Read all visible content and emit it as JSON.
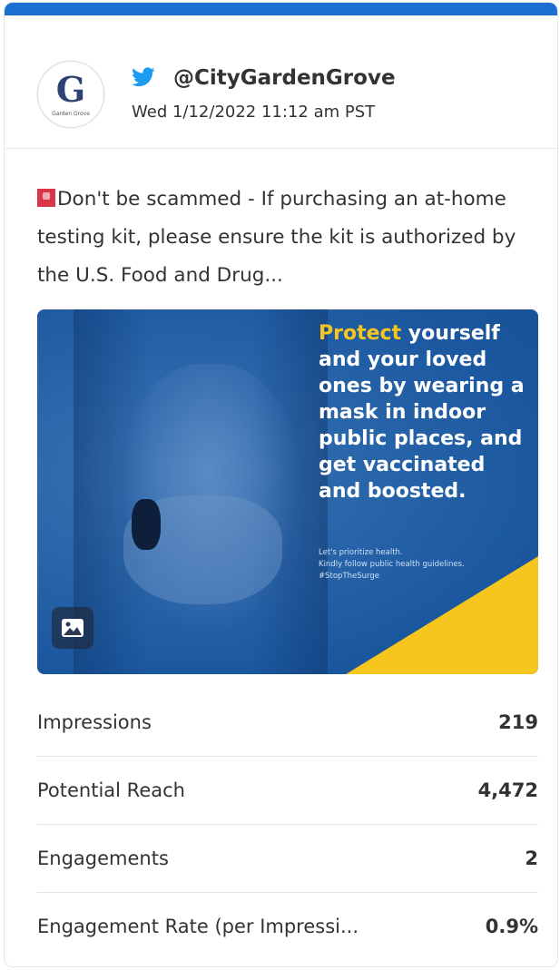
{
  "post": {
    "network_icon": "twitter-bird-icon",
    "handle": "@CityGardenGrove",
    "timestamp": "Wed 1/12/2022 11:12 am PST",
    "avatar_letter": "G",
    "avatar_caption": "Garden Grove",
    "alert_icon": "red-alert-square-icon",
    "text": "Don't be scammed - If purchasing an at-home testing kit, please ensure the kit is authorized by the U.S. Food and Drug..."
  },
  "media": {
    "headline_highlight": "Protect",
    "headline_rest": " yourself and your loved ones by wearing a mask in indoor public places, and get vaccinated and boosted.",
    "line1": "Let's prioritize health.",
    "line2": "Kindly follow public health guidelines.",
    "line3": "#StopTheSurge",
    "badge_icon": "image-icon",
    "colors": {
      "blue": "#1d5fa8",
      "yellow": "#f6c51e"
    }
  },
  "stats": [
    {
      "label": "Impressions",
      "value": "219"
    },
    {
      "label": "Potential Reach",
      "value": "4,472"
    },
    {
      "label": "Engagements",
      "value": "2"
    },
    {
      "label": "Engagement Rate (per Impressi...",
      "value": "0.9%"
    }
  ],
  "colors": {
    "accent_bar": "#1b6fd1",
    "twitter": "#1d9bf0"
  }
}
